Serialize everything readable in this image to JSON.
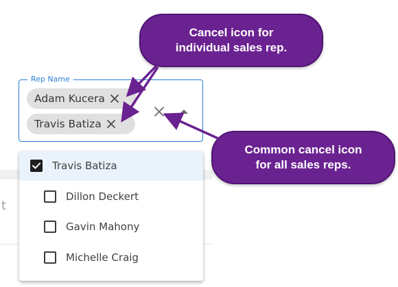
{
  "field": {
    "label": "Rep Name",
    "chips": [
      {
        "label": "Adam Kucera",
        "remove_icon": "close-icon"
      },
      {
        "label": "Travis Batiza",
        "remove_icon": "close-icon"
      }
    ],
    "clear_icon": "close-icon",
    "toggle_icon": "caret-up-icon"
  },
  "menu": {
    "options": [
      {
        "label": "Travis Batiza",
        "checked": true
      },
      {
        "label": "Dillon Deckert",
        "checked": false
      },
      {
        "label": "Gavin Mahony",
        "checked": false
      },
      {
        "label": "Michelle Craig",
        "checked": false
      }
    ]
  },
  "callouts": {
    "top": {
      "line1": "Cancel icon for",
      "line2": "individual sales rep."
    },
    "bottom": {
      "line1": "Common cancel icon",
      "line2": "for all sales reps."
    }
  },
  "colors": {
    "accent": "#2a7fd8",
    "callout": "#6b2291",
    "chip": "#e0e0e0",
    "selected_row": "#eaf2fb"
  }
}
